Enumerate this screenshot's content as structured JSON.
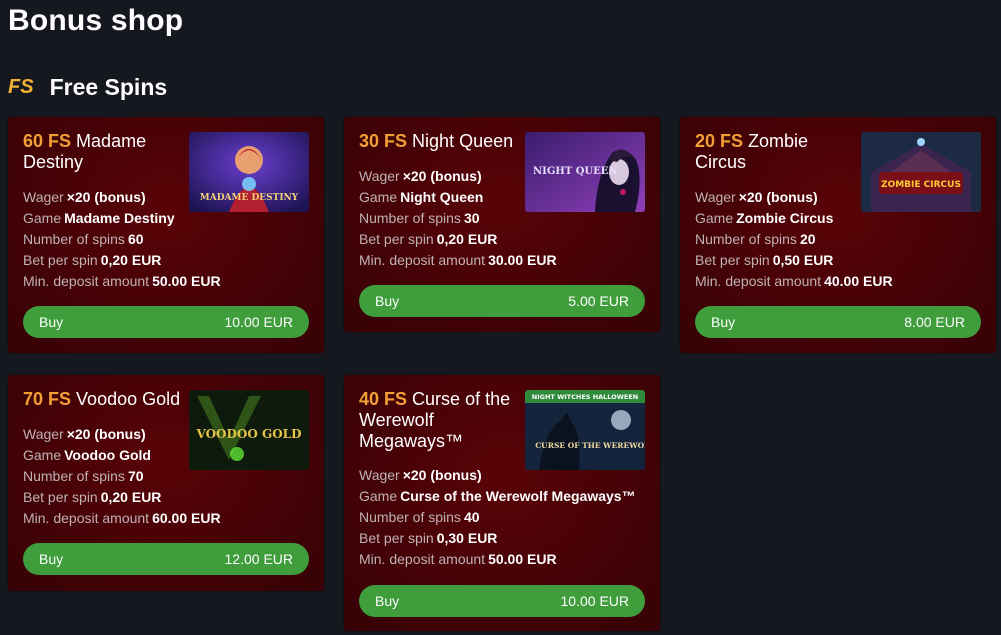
{
  "page": {
    "title": "Bonus shop"
  },
  "section": {
    "badge": "FS",
    "title": "Free Spins"
  },
  "labels": {
    "wager": "Wager",
    "game": "Game",
    "spins": "Number of spins",
    "bet": "Bet per spin",
    "deposit": "Min. deposit amount",
    "buy": "Buy"
  },
  "offers": [
    {
      "fs": "60 FS",
      "name": "Madame Destiny",
      "wager": "×20 (bonus)",
      "game": "Madame Destiny",
      "spins": "60",
      "bet": "0,20 EUR",
      "deposit": "50.00 EUR",
      "price": "10.00 EUR",
      "thumb_text": "MADAME DESTINY"
    },
    {
      "fs": "30 FS",
      "name": "Night Queen",
      "wager": "×20 (bonus)",
      "game": "Night Queen",
      "spins": "30",
      "bet": "0,20 EUR",
      "deposit": "30.00 EUR",
      "price": "5.00 EUR",
      "thumb_text": "NIGHT QUEEN"
    },
    {
      "fs": "20 FS",
      "name": "Zombie Circus",
      "wager": "×20 (bonus)",
      "game": "Zombie Circus",
      "spins": "20",
      "bet": "0,50 EUR",
      "deposit": "40.00 EUR",
      "price": "8.00 EUR",
      "thumb_text": "ZOMBIE CIRCUS"
    },
    {
      "fs": "70 FS",
      "name": "Voodoo Gold",
      "wager": "×20 (bonus)",
      "game": "Voodoo Gold",
      "spins": "70",
      "bet": "0,20 EUR",
      "deposit": "60.00 EUR",
      "price": "12.00 EUR",
      "thumb_text": "VOODOO GOLD"
    },
    {
      "fs": "40 FS",
      "name": "Curse of the Werewolf Megaways™",
      "wager": "×20 (bonus)",
      "game": "Curse of the Werewolf Megaways™",
      "spins": "40",
      "bet": "0,30 EUR",
      "deposit": "50.00 EUR",
      "price": "10.00 EUR",
      "thumb_text": "CURSE OF THE WEREWOLF",
      "thumb_banner": "NIGHT WITCHES HALLOWEEN"
    }
  ],
  "colors": {
    "accent": "#f2a035",
    "button": "#3f9d3c",
    "card": "#4a0207",
    "background": "#16181f"
  }
}
